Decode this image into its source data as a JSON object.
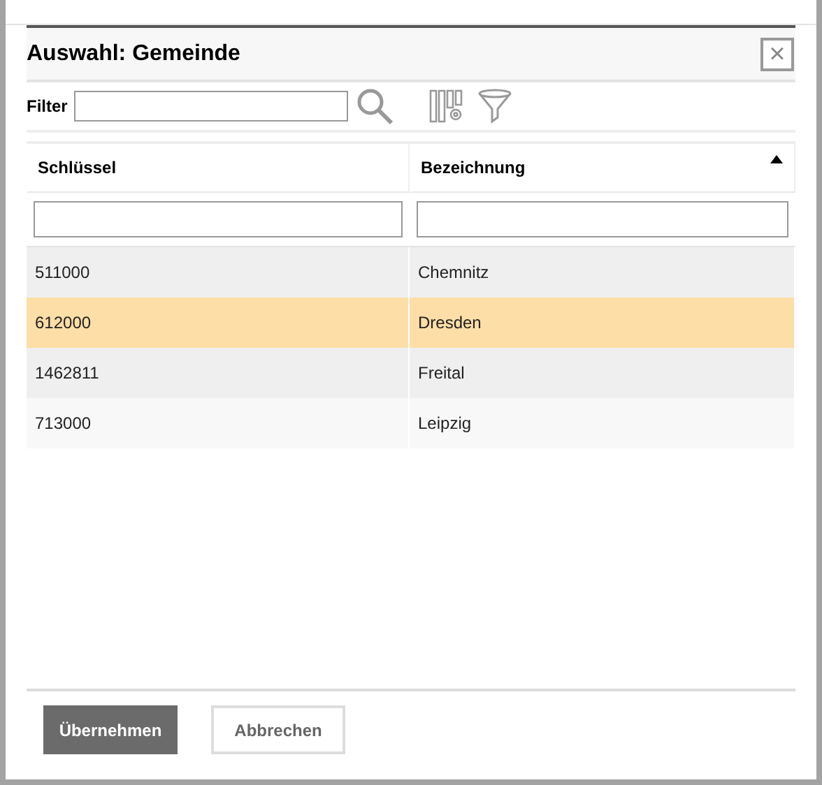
{
  "dialog": {
    "title": "Auswahl: Gemeinde",
    "close": "×"
  },
  "filter": {
    "label": "Filter"
  },
  "table": {
    "columns": [
      {
        "label": "Schlüssel",
        "sorted": false
      },
      {
        "label": "Bezeichnung",
        "sorted": true
      }
    ],
    "rows": [
      {
        "cells": [
          "511000",
          "Chemnitz"
        ],
        "selected": false
      },
      {
        "cells": [
          "612000",
          "Dresden"
        ],
        "selected": true
      },
      {
        "cells": [
          "1462811",
          "Freital"
        ],
        "selected": false
      },
      {
        "cells": [
          "713000",
          "Leipzig"
        ],
        "selected": false
      }
    ]
  },
  "buttons": [
    {
      "label": "Übernehmen",
      "kind": "primary"
    },
    {
      "label": "Abbrechen",
      "kind": "secondary"
    }
  ]
}
